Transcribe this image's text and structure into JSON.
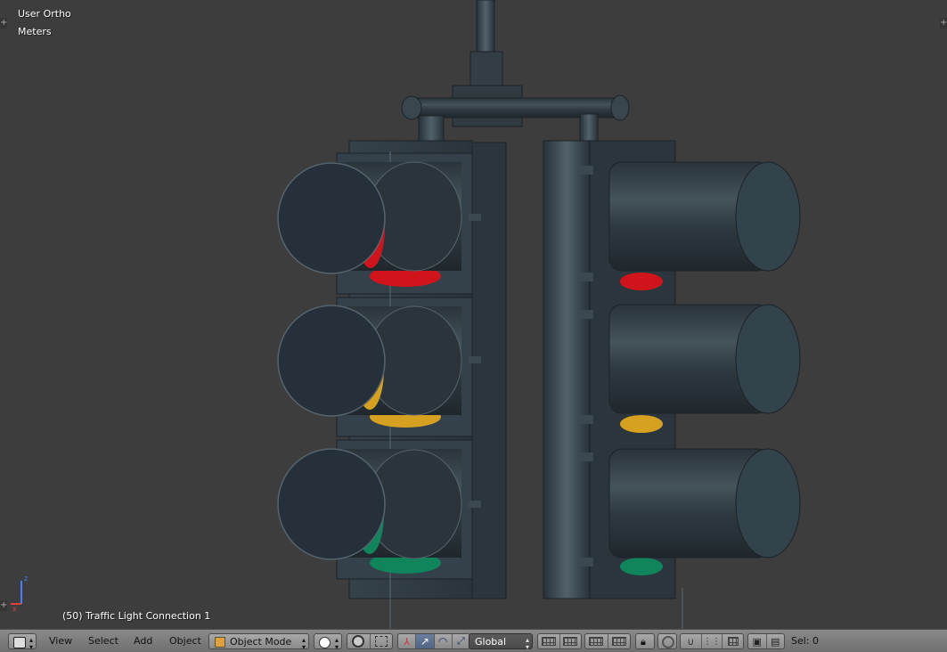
{
  "viewport": {
    "view_name": "User Ortho",
    "units": "Meters",
    "object_info": "(50) Traffic Light Connection 1",
    "axes": {
      "x_label": "x",
      "z_label": "z"
    }
  },
  "header": {
    "editor_type_icon": "3d-view-icon",
    "menus": {
      "view": "View",
      "select": "Select",
      "add": "Add",
      "object": "Object"
    },
    "mode_select": "Object Mode",
    "pivot_icon": "pivot-bounding-box-icon",
    "orientation_select": "Global",
    "selection_status": "Sel: 0"
  },
  "colors": {
    "viewport_bg": "#3d3d3d",
    "housing": "#2d373d",
    "red_lens": "#d0141c",
    "amber_lens": "#d6a020",
    "green_lens": "#10855c",
    "header_bg": "#808080",
    "active_button": "#5a7090"
  }
}
